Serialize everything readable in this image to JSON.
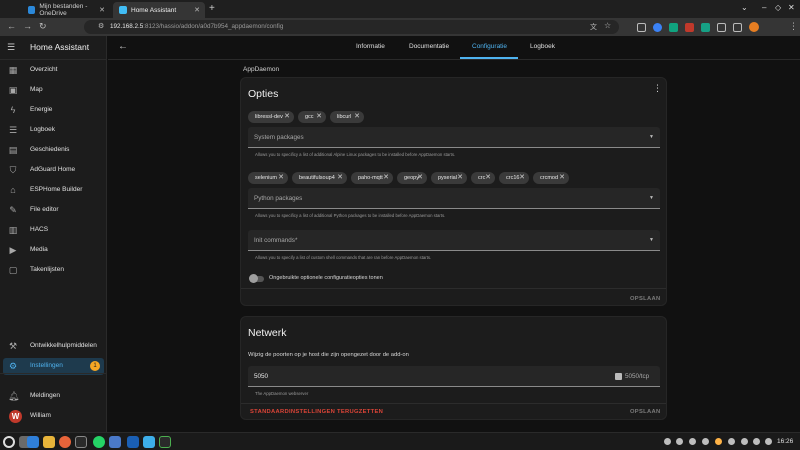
{
  "browser": {
    "tabs": [
      {
        "title": "Mijn bestanden - OneDrive",
        "active": false
      },
      {
        "title": "Home Assistant",
        "active": true
      }
    ],
    "url_host": "192.168.2.5",
    "url_rest": ":8123/hassio/addon/a0d7b954_appdaemon/config"
  },
  "sidebar": {
    "title": "Home Assistant",
    "items": [
      {
        "label": "Overzicht",
        "icon": "grid-icon"
      },
      {
        "label": "Map",
        "icon": "map-icon"
      },
      {
        "label": "Energie",
        "icon": "lightning-icon"
      },
      {
        "label": "Logboek",
        "icon": "list-icon"
      },
      {
        "label": "Geschiedenis",
        "icon": "chart-icon"
      },
      {
        "label": "AdGuard Home",
        "icon": "shield-icon"
      },
      {
        "label": "ESPHome Builder",
        "icon": "esphome-icon"
      },
      {
        "label": "File editor",
        "icon": "wrench-icon"
      },
      {
        "label": "HACS",
        "icon": "hacs-icon"
      },
      {
        "label": "Media",
        "icon": "media-icon"
      },
      {
        "label": "Takenlijsten",
        "icon": "clipboard-icon"
      }
    ],
    "bottom_items": [
      {
        "label": "Ontwikkelhulpmiddelen",
        "icon": "hammer-icon"
      },
      {
        "label": "Instellingen",
        "icon": "gear-icon",
        "badge": "1"
      },
      {
        "label": "Meldingen",
        "icon": "bell-icon"
      },
      {
        "label": "William",
        "icon": "avatar",
        "initial": "W"
      }
    ]
  },
  "toolbar": {
    "tabs": [
      "Informatie",
      "Documentatie",
      "Configuratie",
      "Logboek"
    ],
    "active_tab": "Configuratie"
  },
  "addon_name": "AppDaemon",
  "options_card": {
    "title": "Opties",
    "system_packages_chips": [
      "libressl-dev",
      "gcc",
      "libcurl"
    ],
    "system_packages_label": "System packages",
    "system_packages_help": "Allows you to specificy a list of additional Alpine Linux packages to be installed before AppDaemon starts.",
    "python_packages_chips": [
      "selenium",
      "beautifulsoup4",
      "paho-mqtt",
      "geopy",
      "pyserial",
      "crc",
      "crc16",
      "crcmod"
    ],
    "python_packages_label": "Python packages",
    "python_packages_help": "Allows you to specificy a list of additional Python packages to be installed before AppDaemon starts.",
    "init_commands_label": "Init commands*",
    "init_commands_help": "Allows you to specify a list of custom shell commands that are ran before AppDaemon starts.",
    "toggle_label": "Ongebruikte optionele configuratieopties tonen",
    "save_label": "OPSLAAN"
  },
  "network_card": {
    "title": "Netwerk",
    "description": "Wijzig de poorten op je host die zijn opengezet door de add-on",
    "port_value": "5050",
    "port_suffix": "5050/tcp",
    "port_help": "The AppDaemon webserver",
    "reset_label": "STANDAARDINSTELLINGEN TERUGZETTEN",
    "save_label": "OPSLAAN"
  },
  "taskbar": {
    "clock": "16:26"
  },
  "colors": {
    "accent": "#4fb3f0",
    "danger": "#db4437",
    "badge": "#f5a623"
  }
}
